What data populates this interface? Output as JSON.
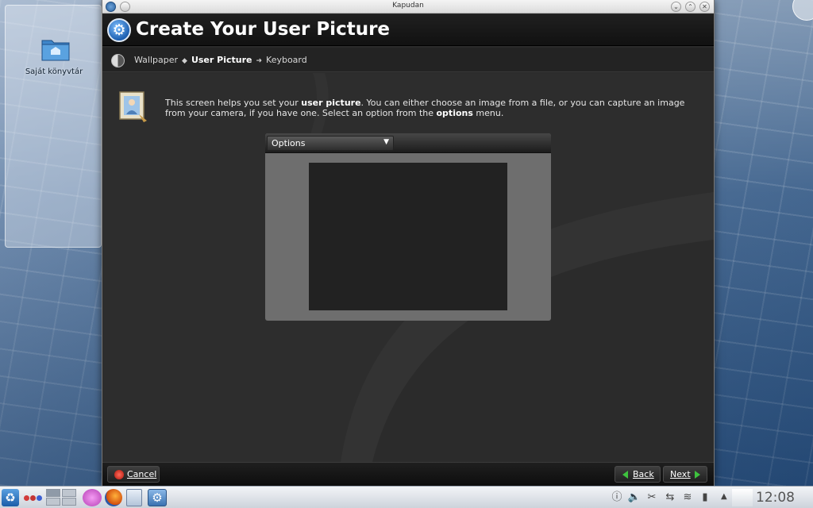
{
  "desktop": {
    "folder_label": "Saját könyvtár"
  },
  "window": {
    "title": "Kapudan"
  },
  "header": {
    "title": "Create Your User Picture"
  },
  "breadcrumb": {
    "items": [
      "Wallpaper",
      "User Picture",
      "Keyboard"
    ],
    "current_index": 1
  },
  "content": {
    "desc_1": "This screen helps you set your ",
    "desc_bold_1": "user picture",
    "desc_2": ". You can either choose an image from a file, or you can capture an image from your camera, if you have one. Select an option from the ",
    "desc_bold_2": "options",
    "desc_3": " menu.",
    "options_label": "Options"
  },
  "footer": {
    "cancel_label": "Cancel",
    "back_label": "Back",
    "next_label": "Next"
  },
  "taskbar": {
    "clock": "12:08"
  },
  "colors": {
    "accent_blue": "#1d5fb0",
    "nav_green": "#3ec23e",
    "cancel_red": "#b0160c"
  }
}
